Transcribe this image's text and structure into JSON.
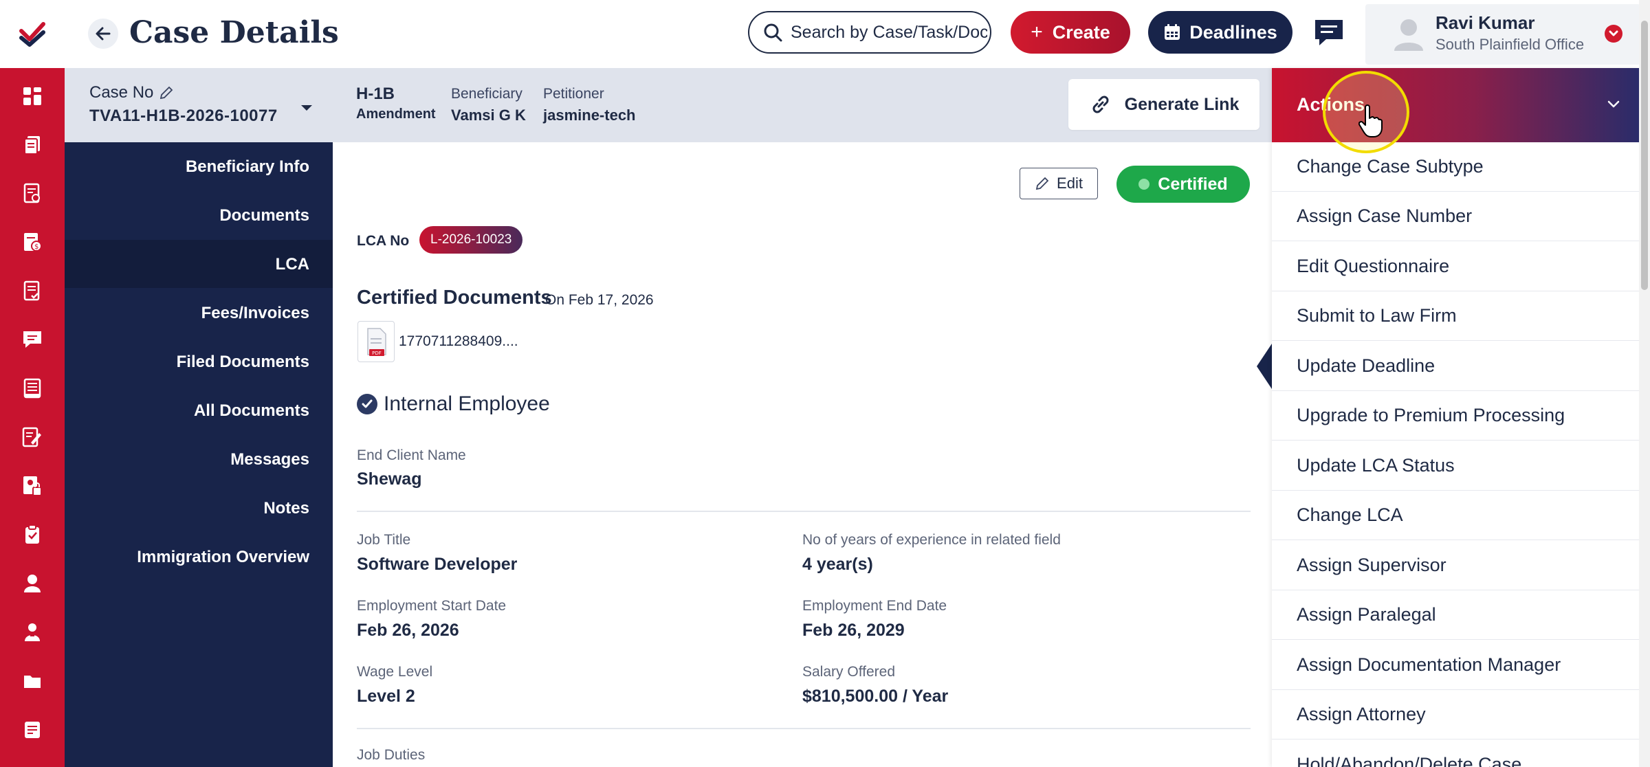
{
  "header": {
    "title": "Case Details",
    "search_placeholder": "Search by Case/Task/Docu",
    "create_label": "Create",
    "deadlines_label": "Deadlines",
    "user_name": "Ravi Kumar",
    "user_office": "South Plainfield Office"
  },
  "case": {
    "case_no_label": "Case No",
    "case_no_value": "TVA11-H1B-2026-10077",
    "visa_type": "H-1B",
    "visa_subtype": "Amendment",
    "beneficiary_label": "Beneficiary",
    "beneficiary_value": "Vamsi G K",
    "petitioner_label": "Petitioner",
    "petitioner_value": "jasmine-tech",
    "generate_link_label": "Generate Link"
  },
  "subnav": {
    "items": [
      "Beneficiary Info",
      "Documents",
      "LCA",
      "Fees/Invoices",
      "Filed Documents",
      "All Documents",
      "Messages",
      "Notes",
      "Immigration Overview"
    ],
    "active": "LCA"
  },
  "lca": {
    "edit_label": "Edit",
    "status": "Certified",
    "lca_no_label": "LCA No",
    "lca_no_value": "L-2026-10023",
    "certified_docs_title": "Certified Documents",
    "certified_docs_date": "On Feb 17, 2026",
    "file_name": "1770711288409....",
    "section_title": "Internal Employee",
    "fields": {
      "end_client_label": "End Client Name",
      "end_client_value": "Shewag",
      "job_title_label": "Job Title",
      "job_title_value": "Software Developer",
      "experience_label": "No of years of experience in related field",
      "experience_value": "4 year(s)",
      "start_date_label": "Employment Start Date",
      "start_date_value": "Feb 26, 2026",
      "end_date_label": "Employment End Date",
      "end_date_value": "Feb 26, 2029",
      "wage_level_label": "Wage Level",
      "wage_level_value": "Level 2",
      "salary_label": "Salary Offered",
      "salary_value": "$810,500.00 / Year",
      "job_duties_label": "Job Duties"
    }
  },
  "actions": {
    "title": "Actions",
    "items": [
      "Change Case Subtype",
      "Assign Case Number",
      "Edit Questionnaire",
      "Submit to Law Firm",
      "Update Deadline",
      "Upgrade to Premium Processing",
      "Update LCA Status",
      "Change LCA",
      "Assign Supervisor",
      "Assign Paralegal",
      "Assign Documentation Manager",
      "Assign Attorney",
      "Hold/Abandon/Delete Case"
    ]
  },
  "colors": {
    "brand_red": "#c8132f",
    "navy": "#18244a",
    "certified_green": "#1ea84a"
  },
  "icons": {
    "rail": [
      "dashboard-icon",
      "cases-icon",
      "tasks-icon",
      "invoices-icon",
      "forms-icon",
      "messages-icon",
      "reports-icon",
      "notes-icon",
      "documents-lock-icon",
      "clipboard-icon",
      "user-icon",
      "team-icon",
      "folder-icon",
      "notepad-icon"
    ]
  }
}
